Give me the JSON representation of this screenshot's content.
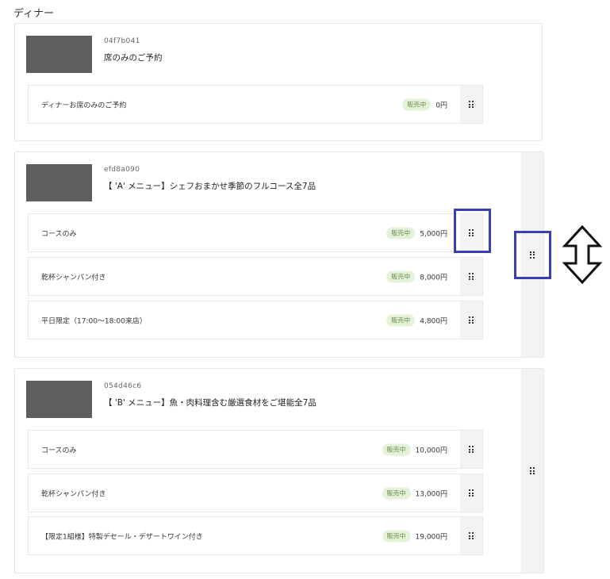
{
  "section": {
    "title": "ディナー"
  },
  "groups": [
    {
      "code": "04f7b041",
      "title": "席のみのご予約",
      "items": [
        {
          "name": "ディナーお席のみのご予約",
          "status": "販売中",
          "price": "0円"
        }
      ]
    },
    {
      "code": "efd8a090",
      "title": "【 'A' メニュー】シェフおまかせ季節のフルコース全7品",
      "items": [
        {
          "name": "コースのみ",
          "status": "販売中",
          "price": "5,000円"
        },
        {
          "name": "乾杯シャンパン付き",
          "status": "販売中",
          "price": "8,000円"
        },
        {
          "name": "平日限定（17:00～18:00来店）",
          "status": "販売中",
          "price": "4,800円"
        }
      ]
    },
    {
      "code": "054d46c6",
      "title": "【 'B' メニュー】魚・肉料理含む厳選食材をご堪能全7品",
      "items": [
        {
          "name": "コースのみ",
          "status": "販売中",
          "price": "10,000円"
        },
        {
          "name": "乾杯シャンパン付き",
          "status": "販売中",
          "price": "13,000円"
        },
        {
          "name": "【限定1組様】特製デセール・デザートワイン付き",
          "status": "販売中",
          "price": "19,000円"
        }
      ]
    }
  ],
  "icons": {
    "drag_handle": "drag-handle-icon",
    "reorder_arrow": "up-down-arrow-icon"
  },
  "colors": {
    "highlight": "#3b3fb4",
    "badge_bg": "#e4f2d9",
    "badge_text": "#6c8d4f",
    "thumbnail": "#5e5e5e",
    "handle_bg": "#f3f3f3"
  }
}
